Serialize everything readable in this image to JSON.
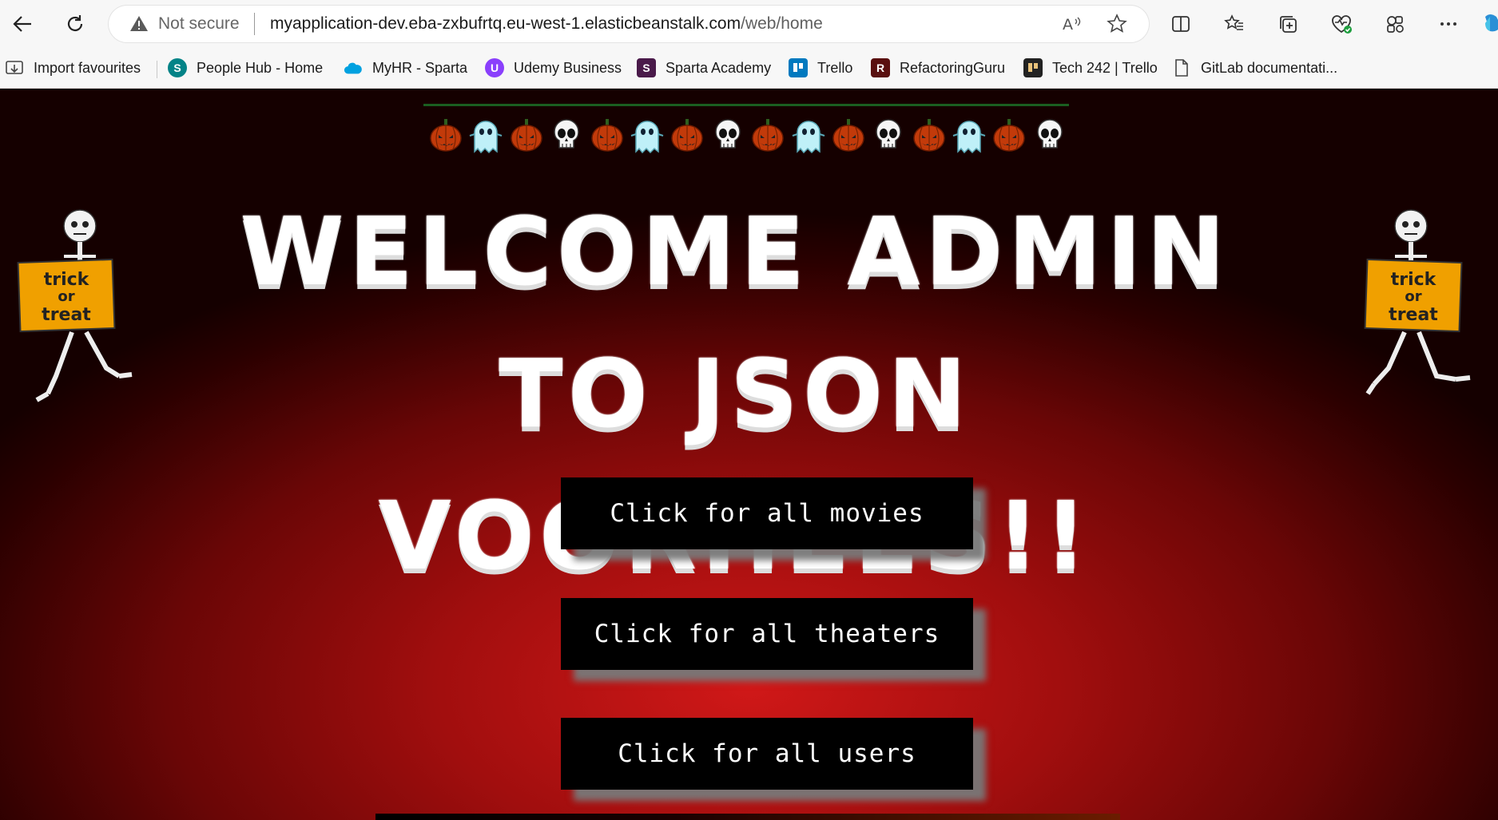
{
  "browser": {
    "security_label": "Not secure",
    "url_host": "myapplication-dev.eba-zxbufrtq.eu-west-1.elasticbeanstalk.com",
    "url_path": "/web/home",
    "icons": [
      "back-icon",
      "refresh-icon",
      "warning-icon",
      "read-aloud-icon",
      "favorite-star-icon",
      "split-screen-icon",
      "favorites-icon",
      "collections-icon",
      "browser-essentials-icon",
      "extensions-icon",
      "more-icon",
      "copilot-icon"
    ]
  },
  "bookmarks": [
    {
      "label": "Import favourites",
      "icon": "import-icon",
      "color": "#444444"
    },
    {
      "label": "People Hub - Home",
      "icon": "sharepoint-icon",
      "color": "#038387"
    },
    {
      "label": "MyHR - Sparta",
      "icon": "salesforce-cloud-icon",
      "color": "#00a1e0"
    },
    {
      "label": "Udemy Business",
      "icon": "udemy-icon",
      "color": "#8a3ffc"
    },
    {
      "label": "Sparta Academy",
      "icon": "sparta-icon",
      "color": "#7b2a7b"
    },
    {
      "label": "Trello",
      "icon": "trello-icon",
      "color": "#0079bf"
    },
    {
      "label": "RefactoringGuru",
      "icon": "refactoringguru-icon",
      "color": "#8b1a1a"
    },
    {
      "label": "Tech 242 | Trello",
      "icon": "trello-board-icon",
      "color": "#222222"
    },
    {
      "label": "GitLab documentati...",
      "icon": "document-icon",
      "color": "#444444"
    }
  ],
  "page": {
    "garland_icons": [
      "pumpkin",
      "ghost",
      "pumpkin",
      "skull",
      "pumpkin",
      "ghost",
      "pumpkin",
      "skull",
      "pumpkin",
      "ghost",
      "pumpkin",
      "skull",
      "pumpkin",
      "ghost",
      "pumpkin",
      "skull"
    ],
    "heading": "WELCOME ADMIN TO JSON VOORHEES!!",
    "sign_text": "trick or treat",
    "buttons": {
      "movies": "Click for all movies",
      "theaters": "Click for all theaters",
      "users": "Click for all users"
    }
  }
}
